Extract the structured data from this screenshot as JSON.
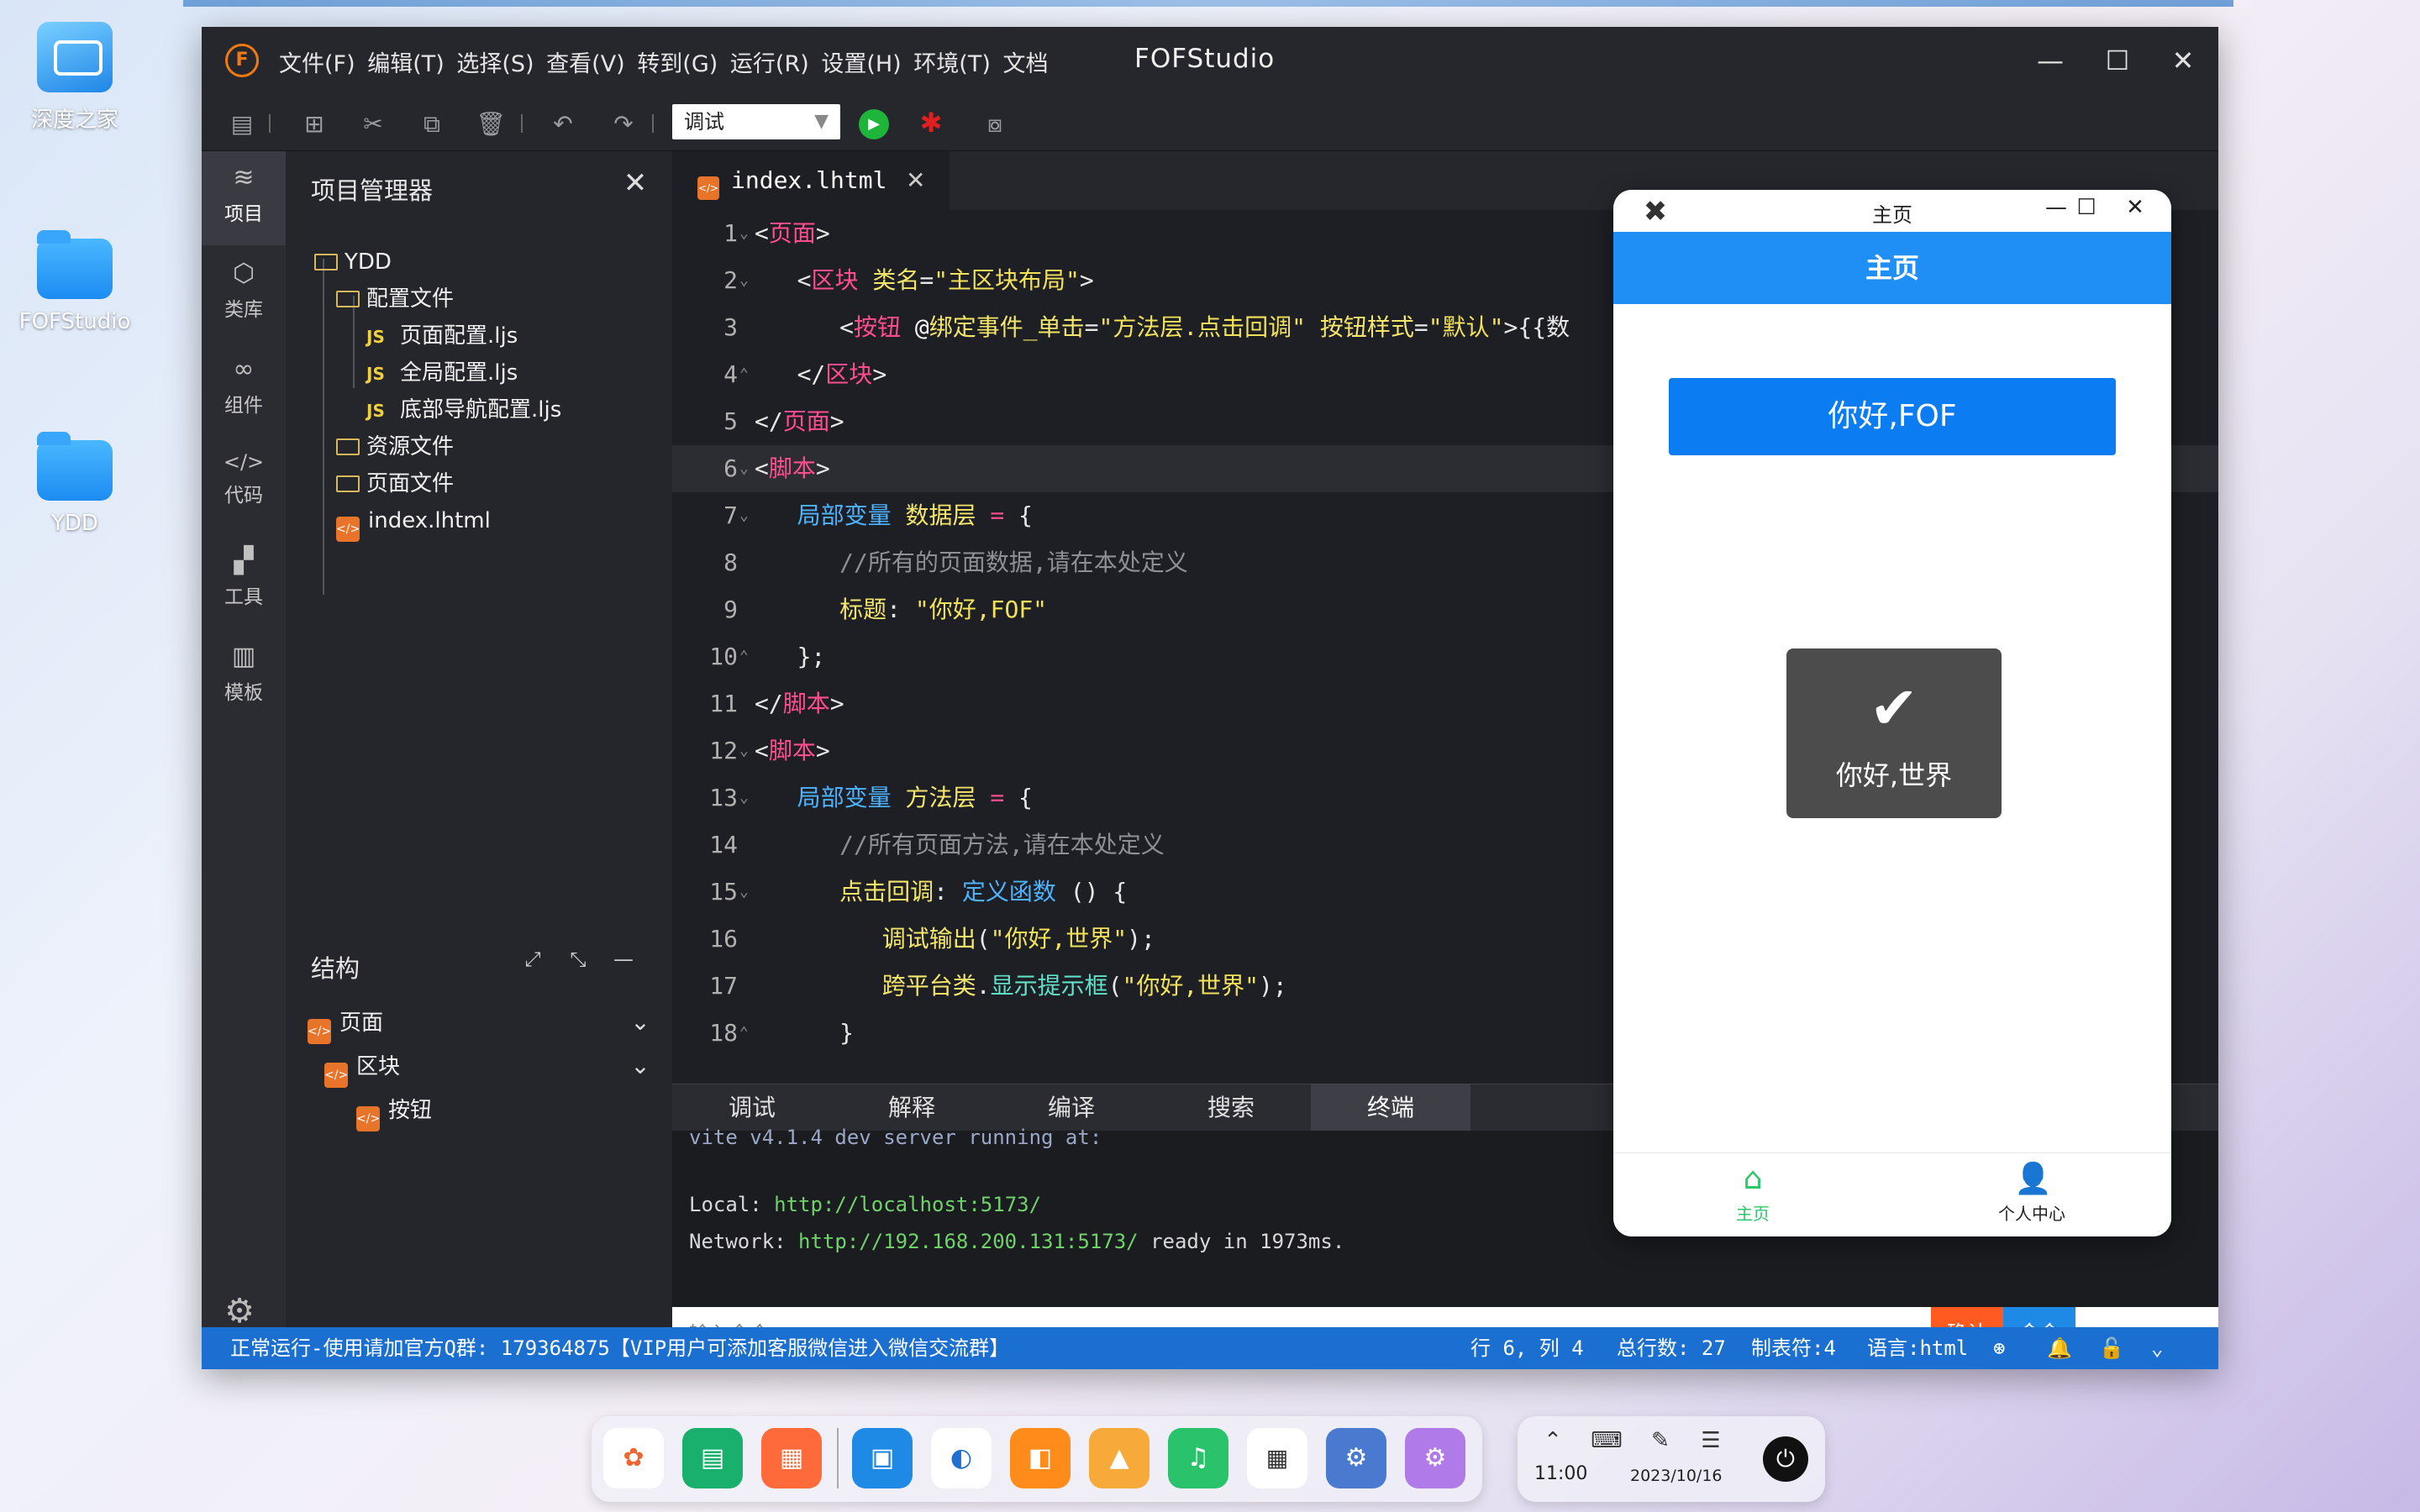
{
  "desktop": {
    "icons": [
      {
        "label": "深度之家"
      },
      {
        "label": "FOFStudio"
      },
      {
        "label": "YDD"
      }
    ]
  },
  "window": {
    "title": "FOFStudio",
    "logo": "F",
    "menu": [
      "文件(F)",
      "编辑(T)",
      "选择(S)",
      "查看(V)",
      "转到(G)",
      "运行(R)",
      "设置(H)",
      "环境(T)",
      "文档"
    ]
  },
  "toolbar": {
    "mode_select": "调试"
  },
  "activity_bar": [
    {
      "label": "项目",
      "icon": "layers-icon"
    },
    {
      "label": "类库",
      "icon": "cube-icon"
    },
    {
      "label": "组件",
      "icon": "link-icon"
    },
    {
      "label": "代码",
      "icon": "code-icon"
    },
    {
      "label": "工具",
      "icon": "tools-icon"
    },
    {
      "label": "模板",
      "icon": "template-icon"
    }
  ],
  "project_panel": {
    "title": "项目管理器",
    "tree": [
      {
        "label": "YDD"
      },
      {
        "label": "配置文件"
      },
      {
        "label": "页面配置.ljs"
      },
      {
        "label": "全局配置.ljs"
      },
      {
        "label": "底部导航配置.ljs"
      },
      {
        "label": "资源文件"
      },
      {
        "label": "页面文件"
      },
      {
        "label": "index.lhtml"
      }
    ]
  },
  "structure_panel": {
    "title": "结构",
    "nodes": [
      {
        "label": "页面"
      },
      {
        "label": "区块"
      },
      {
        "label": "按钮"
      }
    ]
  },
  "editor": {
    "tab": "index.lhtml",
    "line_numbers": [
      "1",
      "2",
      "3",
      "4",
      "5",
      "6",
      "7",
      "8",
      "9",
      "10",
      "11",
      "12",
      "13",
      "14",
      "15",
      "16",
      "17",
      "18"
    ],
    "cursor_line": 6
  },
  "bottom_tabs": [
    "调试",
    "解释",
    "编译",
    "搜索",
    "终端"
  ],
  "terminal": {
    "line1": "vite v4.1.4 dev server running at:",
    "local_label": "Local:",
    "local_url": "http://localhost:5173/",
    "network_label": "Network:",
    "network_url": "http://192.168.200.131:5173/",
    "ready": "ready in 1973ms."
  },
  "command_bar": {
    "placeholder": "输入命令",
    "confirm": "确认",
    "command": "命令"
  },
  "statusbar": {
    "message": "正常运行-使用请加官方Q群: 179364875【VIP用户可添加客服微信进入微信交流群】",
    "position": "行 6, 列 4",
    "total_lines": "总行数: 27",
    "tab_size": "制表符:4",
    "language": "语言:html"
  },
  "preview": {
    "window_title": "主页",
    "header": "主页",
    "button": "你好,FOF",
    "toast": "你好,世界",
    "tabs": [
      {
        "label": "主页",
        "color": "#2ec76b"
      },
      {
        "label": "个人中心",
        "color": "#222222"
      }
    ]
  },
  "tray": {
    "time": "11:00",
    "date": "2023/10/16"
  },
  "colors": {
    "accent": "#1f8ef5",
    "statusbar": "#1b6fd0",
    "confirm": "#ff5a1f"
  }
}
